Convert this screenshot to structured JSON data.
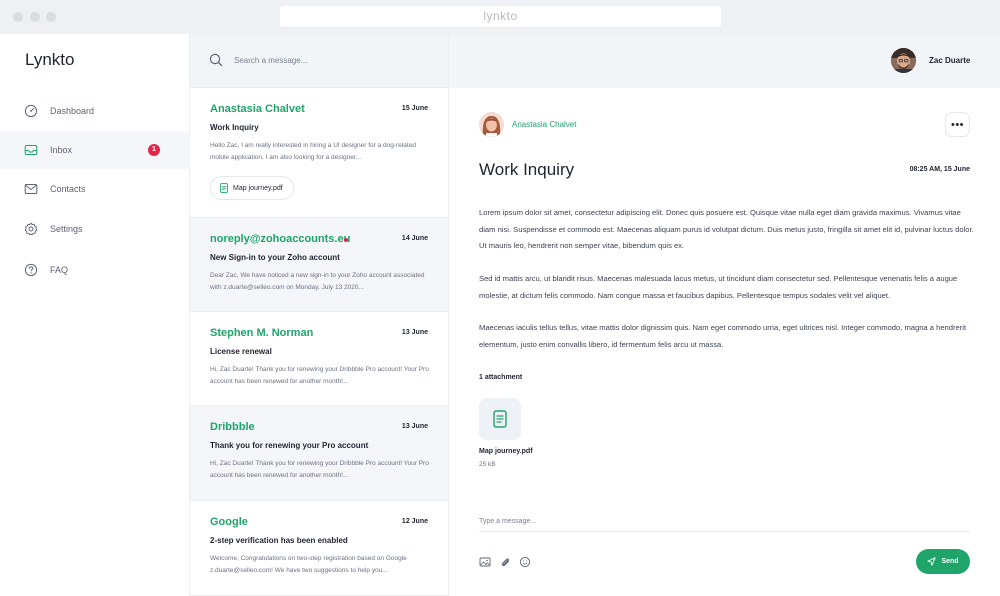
{
  "browser": {
    "url": "lynkto"
  },
  "app": {
    "name": "Lynkto"
  },
  "sidebar": {
    "items": [
      {
        "label": "Dashboard",
        "icon": "gauge-icon"
      },
      {
        "label": "Inbox",
        "icon": "inbox-icon",
        "badge": "1",
        "active": true
      },
      {
        "label": "Contacts",
        "icon": "contacts-icon"
      },
      {
        "label": "Settings",
        "icon": "gear-icon"
      },
      {
        "label": "FAQ",
        "icon": "question-icon"
      }
    ]
  },
  "search": {
    "placeholder": "Search a message..."
  },
  "messages": [
    {
      "sender": "Anastasia Chalvet",
      "date": "15 June",
      "subject": "Work Inquiry",
      "preview": "Hello Zac, I am really interested in hiring a UI designer for a dog-related mobile application. I am also looking for a designer...",
      "attachment": "Map journey.pdf",
      "unread": false
    },
    {
      "sender": "noreply@zohoaccounts.eu",
      "date": "14 June",
      "subject": "New Sign-in to your Zoho account",
      "preview": "Dear Zac, We have noticed a new sign-in to your Zoho account associated with z.duarte@selleo.com on Monday, July 13 2020...",
      "unread": true
    },
    {
      "sender": "Stephen M. Norman",
      "date": "13 June",
      "subject": "License renewal",
      "preview": "Hi, Zac Duarte! Thank you for renewing your Dribbble Pro account! Your Pro account has been renewed for another month!...",
      "unread": false
    },
    {
      "sender": "Dribbble",
      "date": "13 June",
      "subject": "Thank you for renewing your Pro account",
      "preview": "Hi, Zac Duarte! Thank you for renewing your Dribbble Pro account! Your Pro account has been renewed for another month!...",
      "unread": false
    },
    {
      "sender": "Google",
      "date": "12 June",
      "subject": "2-step verification has been enabled",
      "preview": "Welcome, Congratulations on two-step registration based on Google z.duarte@selleo.com! We have two suggestions to help you...",
      "unread": false
    }
  ],
  "header": {
    "user_name": "Zac Duarte"
  },
  "reading": {
    "sender": "Anastasia Chalvet",
    "subject": "Work Inquiry",
    "timestamp": "08:25 AM, 15 June",
    "more": "•••",
    "paragraphs": [
      "Lorem ipsum dolor sit amet, consectetur adipiscing elit. Donec quis posuere est. Quisque vitae nulla eget diam gravida maximus. Vivamus vitae diam nisi. Suspendisse et commodo est. Maecenas aliquam purus id volutpat dictum. Duis metus justo, fringilla sit amet elit id, pulvinar luctus dolor. Ut mauris leo, hendrerit non semper vitae, bibendum quis ex.",
      "Sed id mattis arcu, ut blandit risus. Maecenas malesuada lacus metus, ut tincidunt diam consectetur sed. Pellentesque venenatis felis a augue molestie, at dictum felis commodo. Nam congue massa et faucibus dapibus. Pellentesque tempus sodales velit vel aliquet.",
      "Maecenas iaculis tellus tellus, vitae mattis dolor dignissim quis. Nam eget commodo urna, eget ultrices nisl. Integer commodo, magna a hendrerit elementum, justo enim convallis libero, id fermentum felis arcu ut massa."
    ],
    "attachment_count": "1 attachment",
    "attachment": {
      "name": "Map journey.pdf",
      "size": "25 kB"
    },
    "compose_placeholder": "Type a message...",
    "send_label": "Send"
  },
  "colors": {
    "accent": "#1fa46a",
    "badge": "#e6254a",
    "muted_bg": "#f2f5f8"
  }
}
